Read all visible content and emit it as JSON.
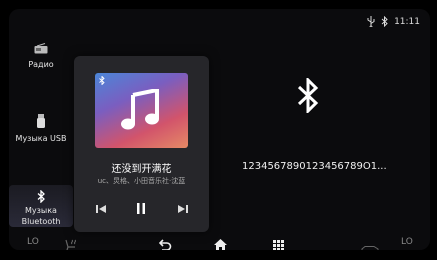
{
  "status": {
    "time": "11:11",
    "icons": [
      "usb-icon",
      "bluetooth-icon"
    ]
  },
  "sidebar": {
    "items": [
      {
        "label": "Радио",
        "icon": "radio-icon"
      },
      {
        "label": "Музыка USB",
        "icon": "usb-stick-icon"
      },
      {
        "label_line1": "Музыка",
        "label_line2": "Bluetooth",
        "icon": "bluetooth-icon",
        "active": true
      }
    ]
  },
  "player": {
    "song_title": "还没到开满花",
    "artist": "uc、炅格、小田音乐社·沈蓝",
    "controls": [
      "previous-icon",
      "pause-icon",
      "next-icon"
    ]
  },
  "bluetooth": {
    "device_name": "1234567890123456789O1..."
  },
  "bottom_bar": {
    "left_climate": "LO",
    "right_climate": "LO",
    "icons": [
      "seat-heat-icon",
      "back-icon",
      "home-icon",
      "apps-grid-icon",
      "car-icon"
    ]
  },
  "colors": {
    "background": "#0b0b0d",
    "card": "#26262a",
    "text": "#ffffff",
    "muted": "#888888"
  }
}
